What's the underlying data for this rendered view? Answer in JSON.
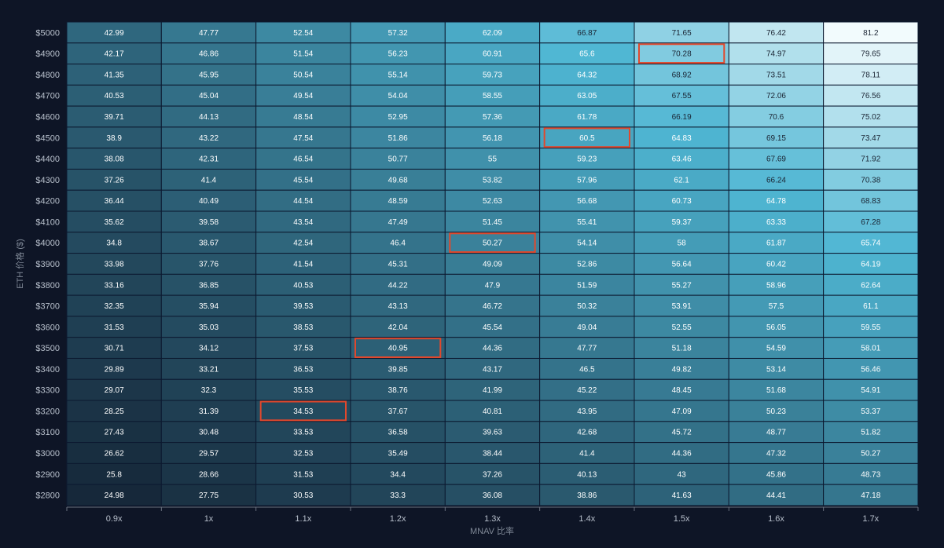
{
  "chart_data": {
    "type": "heatmap",
    "title": "",
    "xlabel": "MNAV 比率",
    "ylabel": "ETH 价格 ($)",
    "x_categories": [
      "0.9x",
      "1x",
      "1.1x",
      "1.2x",
      "1.3x",
      "1.4x",
      "1.5x",
      "1.6x",
      "1.7x"
    ],
    "y_categories": [
      "$5000",
      "$4900",
      "$4800",
      "$4700",
      "$4600",
      "$4500",
      "$4400",
      "$4300",
      "$4200",
      "$4100",
      "$4000",
      "$3900",
      "$3800",
      "$3700",
      "$3600",
      "$3500",
      "$3400",
      "$3300",
      "$3200",
      "$3100",
      "$3000",
      "$2900",
      "$2800"
    ],
    "values": [
      [
        "42.99",
        "47.77",
        "52.54",
        "57.32",
        "62.09",
        "66.87",
        "71.65",
        "76.42",
        "81.2"
      ],
      [
        "42.17",
        "46.86",
        "51.54",
        "56.23",
        "60.91",
        "65.6",
        "70.28",
        "74.97",
        "79.65"
      ],
      [
        "41.35",
        "45.95",
        "50.54",
        "55.14",
        "59.73",
        "64.32",
        "68.92",
        "73.51",
        "78.11"
      ],
      [
        "40.53",
        "45.04",
        "49.54",
        "54.04",
        "58.55",
        "63.05",
        "67.55",
        "72.06",
        "76.56"
      ],
      [
        "39.71",
        "44.13",
        "48.54",
        "52.95",
        "57.36",
        "61.78",
        "66.19",
        "70.6",
        "75.02"
      ],
      [
        "38.9",
        "43.22",
        "47.54",
        "51.86",
        "56.18",
        "60.5",
        "64.83",
        "69.15",
        "73.47"
      ],
      [
        "38.08",
        "42.31",
        "46.54",
        "50.77",
        "55",
        "59.23",
        "63.46",
        "67.69",
        "71.92"
      ],
      [
        "37.26",
        "41.4",
        "45.54",
        "49.68",
        "53.82",
        "57.96",
        "62.1",
        "66.24",
        "70.38"
      ],
      [
        "36.44",
        "40.49",
        "44.54",
        "48.59",
        "52.63",
        "56.68",
        "60.73",
        "64.78",
        "68.83"
      ],
      [
        "35.62",
        "39.58",
        "43.54",
        "47.49",
        "51.45",
        "55.41",
        "59.37",
        "63.33",
        "67.28"
      ],
      [
        "34.8",
        "38.67",
        "42.54",
        "46.4",
        "50.27",
        "54.14",
        "58",
        "61.87",
        "65.74"
      ],
      [
        "33.98",
        "37.76",
        "41.54",
        "45.31",
        "49.09",
        "52.86",
        "56.64",
        "60.42",
        "64.19"
      ],
      [
        "33.16",
        "36.85",
        "40.53",
        "44.22",
        "47.9",
        "51.59",
        "55.27",
        "58.96",
        "62.64"
      ],
      [
        "32.35",
        "35.94",
        "39.53",
        "43.13",
        "46.72",
        "50.32",
        "53.91",
        "57.5",
        "61.1"
      ],
      [
        "31.53",
        "35.03",
        "38.53",
        "42.04",
        "45.54",
        "49.04",
        "52.55",
        "56.05",
        "59.55"
      ],
      [
        "30.71",
        "34.12",
        "37.53",
        "40.95",
        "44.36",
        "47.77",
        "51.18",
        "54.59",
        "58.01"
      ],
      [
        "29.89",
        "33.21",
        "36.53",
        "39.85",
        "43.17",
        "46.5",
        "49.82",
        "53.14",
        "56.46"
      ],
      [
        "29.07",
        "32.3",
        "35.53",
        "38.76",
        "41.99",
        "45.22",
        "48.45",
        "51.68",
        "54.91"
      ],
      [
        "28.25",
        "31.39",
        "34.53",
        "37.67",
        "40.81",
        "43.95",
        "47.09",
        "50.23",
        "53.37"
      ],
      [
        "27.43",
        "30.48",
        "33.53",
        "36.58",
        "39.63",
        "42.68",
        "45.72",
        "48.77",
        "51.82"
      ],
      [
        "26.62",
        "29.57",
        "32.53",
        "35.49",
        "38.44",
        "41.4",
        "44.36",
        "47.32",
        "50.27"
      ],
      [
        "25.8",
        "28.66",
        "31.53",
        "34.4",
        "37.26",
        "40.13",
        "43",
        "45.86",
        "48.73"
      ],
      [
        "24.98",
        "27.75",
        "30.53",
        "33.3",
        "36.08",
        "38.86",
        "41.63",
        "44.41",
        "47.18"
      ]
    ],
    "highlighted_cells": [
      {
        "price": "$4900",
        "ratio": "1.5x"
      },
      {
        "price": "$4500",
        "ratio": "1.4x"
      },
      {
        "price": "$4000",
        "ratio": "1.3x"
      },
      {
        "price": "$3500",
        "ratio": "1.2x"
      },
      {
        "price": "$3200",
        "ratio": "1.1x"
      }
    ],
    "colors": {
      "background": "#0e1526",
      "scale_low": "#16283a",
      "scale_mid": "#4fb6d3",
      "scale_high": "#f2fbfd",
      "highlight_border": "#e2482c",
      "cell_border": "#0c1930"
    },
    "legend": "none",
    "grid": true
  }
}
